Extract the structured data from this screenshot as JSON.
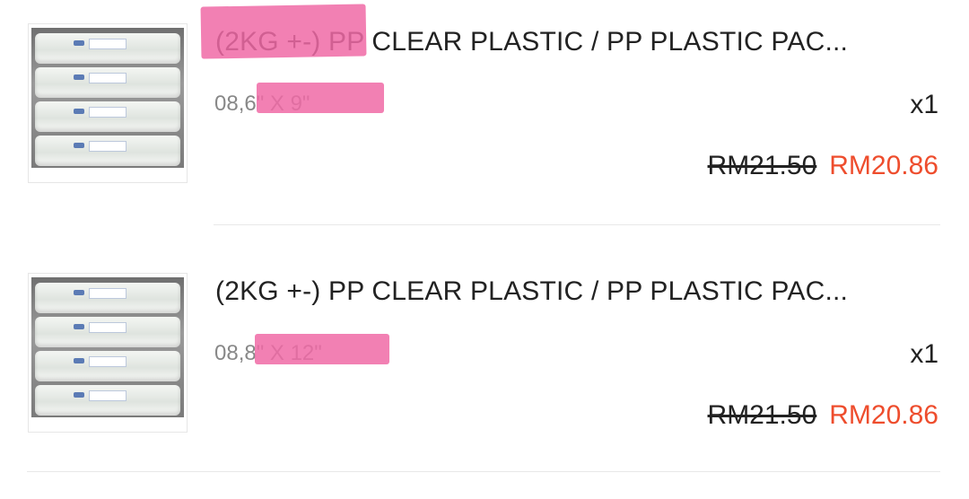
{
  "items": [
    {
      "title": "(2KG +-) PP CLEAR PLASTIC / PP PLASTIC PAC...",
      "variation": "08,6\" X 9\"",
      "quantity": "x1",
      "price_original": "RM21.50",
      "price_current": "RM20.86"
    },
    {
      "title": "(2KG +-) PP CLEAR PLASTIC / PP PLASTIC PAC...",
      "variation": "08,8\" X 12\"",
      "quantity": "x1",
      "price_original": "RM21.50",
      "price_current": "RM20.86"
    }
  ],
  "colors": {
    "price_current": "#ee4d2d",
    "highlight": "#f06aa6",
    "text_primary": "#222222",
    "text_secondary": "#888888"
  }
}
